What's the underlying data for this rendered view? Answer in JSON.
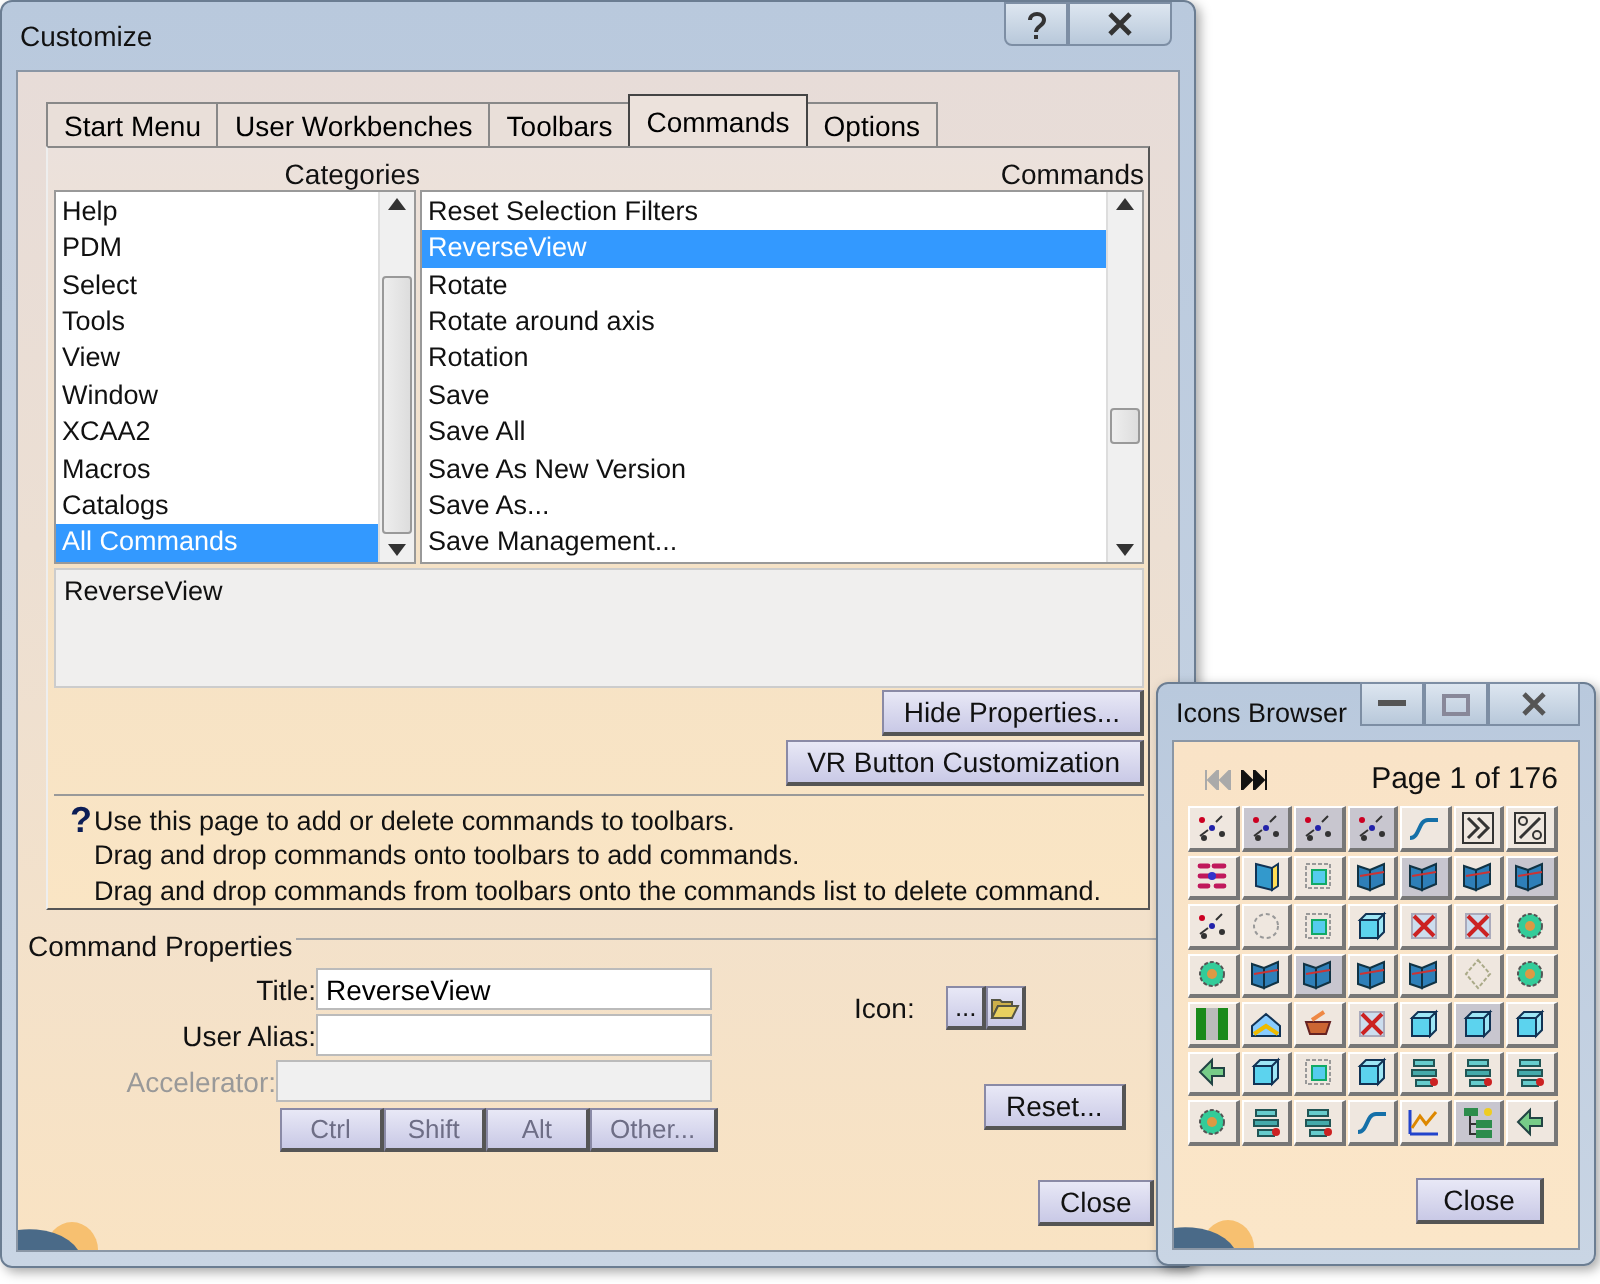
{
  "window": {
    "title": "Customize"
  },
  "tabs": [
    {
      "label": "Start Menu",
      "selected": false
    },
    {
      "label": "User Workbenches",
      "selected": false
    },
    {
      "label": "Toolbars",
      "selected": false
    },
    {
      "label": "Commands",
      "selected": true
    },
    {
      "label": "Options",
      "selected": false
    }
  ],
  "categories": {
    "header": "Categories",
    "items": [
      {
        "label": "Help",
        "selected": false
      },
      {
        "label": "PDM",
        "selected": false
      },
      {
        "label": "Select",
        "selected": false
      },
      {
        "label": "Tools",
        "selected": false
      },
      {
        "label": "View",
        "selected": false
      },
      {
        "label": "Window",
        "selected": false
      },
      {
        "label": "XCAA2",
        "selected": false
      },
      {
        "label": "Macros",
        "selected": false
      },
      {
        "label": "Catalogs",
        "selected": false
      },
      {
        "label": "All Commands",
        "selected": true
      }
    ]
  },
  "commands": {
    "header": "Commands",
    "items": [
      {
        "label": "Reset Selection Filters",
        "selected": false
      },
      {
        "label": "ReverseView",
        "selected": true
      },
      {
        "label": "Rotate",
        "selected": false
      },
      {
        "label": "Rotate around axis",
        "selected": false
      },
      {
        "label": "Rotation",
        "selected": false
      },
      {
        "label": "Save",
        "selected": false
      },
      {
        "label": "Save All",
        "selected": false
      },
      {
        "label": "Save As New Version",
        "selected": false
      },
      {
        "label": "Save As...",
        "selected": false
      },
      {
        "label": "Save Management...",
        "selected": false
      }
    ]
  },
  "description": "ReverseView",
  "side_buttons": [
    "Hide Properties...",
    "VR Button Customization"
  ],
  "help": {
    "mark": "?",
    "lines": [
      "Use this page to add or delete commands to toolbars.",
      "Drag and drop commands onto toolbars to add commands.",
      "Drag and drop commands from toolbars onto the commands list to delete command."
    ]
  },
  "command_properties": {
    "legend": "Command Properties",
    "fields": [
      {
        "label": "Title:",
        "value": "ReverseView",
        "disabled": false
      },
      {
        "label": "User Alias:",
        "disabled": false
      },
      {
        "label": "Accelerator:",
        "disabled": true
      }
    ],
    "modifiers": [
      {
        "label": "Ctrl",
        "disabled": true
      },
      {
        "label": "Shift",
        "disabled": true
      },
      {
        "label": "Alt",
        "disabled": true
      },
      {
        "label": "Other...",
        "disabled": true
      }
    ],
    "icon_label": "Icon:",
    "icon_browse": "...",
    "reset": "Reset...",
    "close": "Close"
  },
  "icons_browser": {
    "title": "Icons Browser",
    "page": "Page 1 of 176",
    "first_disabled": true,
    "last_disabled": false,
    "close": "Close",
    "rows": [
      [
        {
          "kind": "points",
          "highlighted": false
        },
        {
          "kind": "points",
          "highlighted": true
        },
        {
          "kind": "points",
          "highlighted": true
        },
        {
          "kind": "points",
          "highlighted": true
        },
        {
          "kind": "curve",
          "highlighted": false
        },
        {
          "kind": "chevron",
          "highlighted": false
        },
        {
          "kind": "percent",
          "highlighted": false
        }
      ],
      [
        {
          "kind": "network",
          "highlighted": false
        },
        {
          "kind": "book",
          "highlighted": false
        },
        {
          "kind": "box",
          "highlighted": false
        },
        {
          "kind": "panel",
          "highlighted": false
        },
        {
          "kind": "panel",
          "highlighted": true
        },
        {
          "kind": "panel",
          "highlighted": false
        },
        {
          "kind": "panel",
          "highlighted": true
        }
      ],
      [
        {
          "kind": "points",
          "highlighted": false
        },
        {
          "kind": "circle",
          "highlighted": false
        },
        {
          "kind": "box",
          "highlighted": false
        },
        {
          "kind": "cube",
          "highlighted": false
        },
        {
          "kind": "cross",
          "highlighted": false
        },
        {
          "kind": "cross",
          "highlighted": false
        },
        {
          "kind": "gear",
          "highlighted": false
        }
      ],
      [
        {
          "kind": "gear",
          "highlighted": false
        },
        {
          "kind": "panel",
          "highlighted": false
        },
        {
          "kind": "panel",
          "highlighted": true
        },
        {
          "kind": "panel",
          "highlighted": false
        },
        {
          "kind": "panel",
          "highlighted": false
        },
        {
          "kind": "diamond",
          "highlighted": false
        },
        {
          "kind": "gear",
          "highlighted": false
        }
      ],
      [
        {
          "kind": "pillars",
          "highlighted": false
        },
        {
          "kind": "roof",
          "highlighted": false
        },
        {
          "kind": "bowl",
          "highlighted": false
        },
        {
          "kind": "cross",
          "highlighted": false
        },
        {
          "kind": "cube",
          "highlighted": false
        },
        {
          "kind": "cube",
          "highlighted": true
        },
        {
          "kind": "cube",
          "highlighted": false
        }
      ],
      [
        {
          "kind": "arrow",
          "highlighted": false
        },
        {
          "kind": "cube",
          "highlighted": false
        },
        {
          "kind": "box",
          "highlighted": false
        },
        {
          "kind": "cube",
          "highlighted": false
        },
        {
          "kind": "stack",
          "highlighted": false
        },
        {
          "kind": "stack",
          "highlighted": false
        },
        {
          "kind": "stack",
          "highlighted": false
        }
      ],
      [
        {
          "kind": "gear",
          "highlighted": false
        },
        {
          "kind": "stack",
          "highlighted": false
        },
        {
          "kind": "stack",
          "highlighted": false
        },
        {
          "kind": "curve",
          "highlighted": false
        },
        {
          "kind": "chart",
          "highlighted": false
        },
        {
          "kind": "tree",
          "highlighted": true
        },
        {
          "kind": "arrow",
          "highlighted": false
        }
      ]
    ]
  }
}
